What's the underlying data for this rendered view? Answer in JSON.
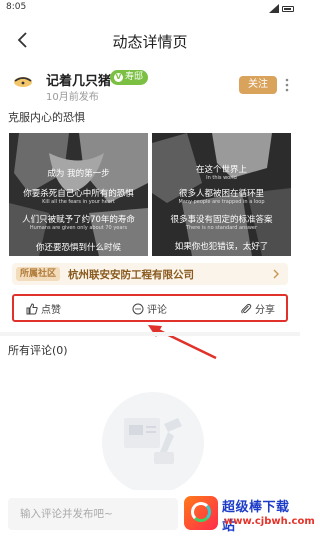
{
  "status_bar": {
    "time": "8:05"
  },
  "header": {
    "title": "动态详情页"
  },
  "post": {
    "username": "记着几只猪",
    "badge": "寿邸",
    "badge_check": "V",
    "time": "10月前发布",
    "follow_label": "关注",
    "text": "克服内心的恐惧",
    "images": [
      {
        "captions": [
          {
            "text": "成为  我的第一步",
            "lang": "cn"
          },
          {
            "text": "你要杀死自己心中所有的恐惧",
            "lang": "cn"
          },
          {
            "text": "Kill all the fears in your heart",
            "lang": "en"
          },
          {
            "text": "人们只被赋予了约70年的寿命",
            "lang": "cn"
          },
          {
            "text": "Humans are given only about 70 years",
            "lang": "en"
          },
          {
            "text": "你还要恐惧到什么时候",
            "lang": "cn"
          }
        ]
      },
      {
        "captions": [
          {
            "text": "在这个世界上",
            "lang": "cn"
          },
          {
            "text": "In this world",
            "lang": "en"
          },
          {
            "text": "很多人都被困在循环里",
            "lang": "cn"
          },
          {
            "text": "Many people are trapped in a loop",
            "lang": "en"
          },
          {
            "text": "很多事没有固定的标准答案",
            "lang": "cn"
          },
          {
            "text": "There is no standard answer",
            "lang": "en"
          },
          {
            "text": "如果你也犯错误，太好了",
            "lang": "cn"
          }
        ]
      }
    ]
  },
  "community": {
    "tag": "所属社区",
    "name": "杭州联安安防工程有限公司"
  },
  "actions": [
    {
      "label": "点赞",
      "icon": "thumbs-up-icon"
    },
    {
      "label": "评论",
      "icon": "comment-icon"
    },
    {
      "label": "分享",
      "icon": "paperclip-share-icon"
    }
  ],
  "comments": {
    "title": "所有评论(0)"
  },
  "bottom_bar": {
    "placeholder": "输入评论并发布吧~"
  },
  "watermark": {
    "title": "超级棒下载站",
    "url": "www.cjbwh.com"
  },
  "colors": {
    "follow": "#d9a35c",
    "badge": "#7bc043",
    "community_bg": "#fbf4ea",
    "community_text": "#8a5a1e",
    "highlight": "#e0312a"
  }
}
